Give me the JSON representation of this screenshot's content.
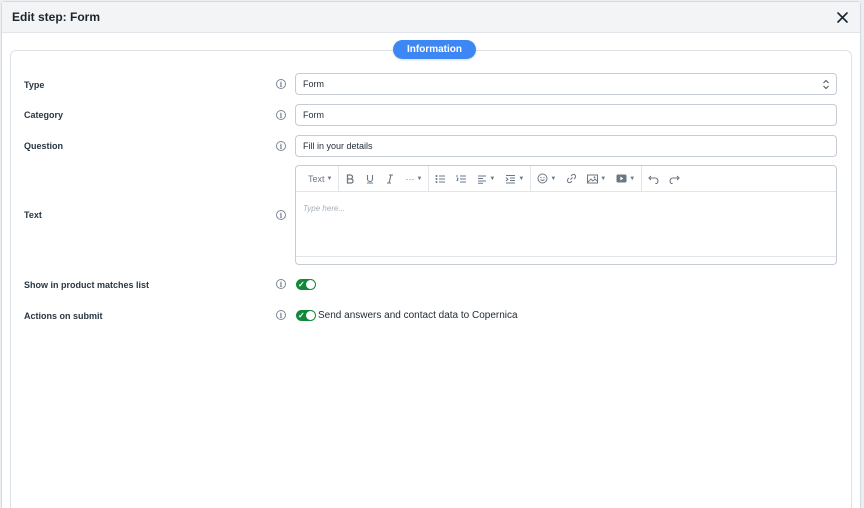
{
  "dialog": {
    "title": "Edit step: Form"
  },
  "section_pill": "Information",
  "fields": {
    "type": {
      "label": "Type",
      "value": "Form"
    },
    "category": {
      "label": "Category",
      "value": "Form"
    },
    "question": {
      "label": "Question",
      "value": "Fill in your details"
    },
    "text": {
      "label": "Text",
      "placeholder": "Type here..."
    },
    "show_in_list": {
      "label": "Show in product matches list",
      "enabled": true
    },
    "actions_on_submit": {
      "label": "Actions on submit",
      "enabled": true,
      "option_text": "Send answers and contact data to Copernica"
    }
  },
  "toolbar": {
    "paragraph_label": "Text",
    "more_label": "···"
  },
  "info_glyph": "i",
  "colors": {
    "accent": "#3d87f5",
    "toggle_on": "#108a3a"
  }
}
